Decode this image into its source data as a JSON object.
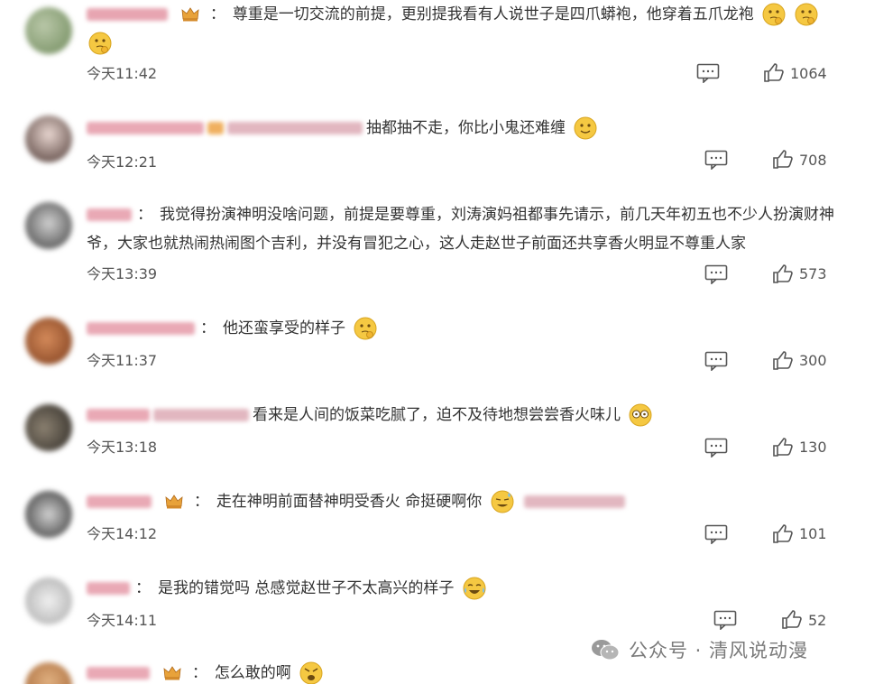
{
  "comments": [
    {
      "text": "尊重是一切交流的前提，更别提我看有人说世子是四爪蟒袍，他穿着五爪龙袍",
      "time": "今天11:42",
      "likes": "1064"
    },
    {
      "text": "抽都抽不走，你比小鬼还难缠",
      "time": "今天12:21",
      "likes": "708"
    },
    {
      "text": "我觉得扮演神明没啥问题，前提是要尊重，刘涛演妈祖都事先请示，前几天年初五也不少人扮演财神爷，大家也就热闹热闹图个吉利，并没有冒犯之心，这人走赵世子前面还共享香火明显不尊重人家",
      "time": "今天13:39",
      "likes": "573"
    },
    {
      "text": "他还蛮享受的样子",
      "time": "今天11:37",
      "likes": "300"
    },
    {
      "text": "看来是人间的饭菜吃腻了，迫不及待地想尝尝香火味儿",
      "time": "今天13:18",
      "likes": "130"
    },
    {
      "text": "走在神明前面替神明受香火 命挺硬啊你",
      "time": "今天14:12",
      "likes": "101"
    },
    {
      "text": "是我的错觉吗 总感觉赵世子不太高兴的样子",
      "time": "今天14:11",
      "likes": "52"
    },
    {
      "text": "怎么敢的啊",
      "time": "",
      "likes": ""
    }
  ],
  "watermark": {
    "text": "公众号 · 清风说动漫"
  },
  "icons": {
    "reply": "comment-icon",
    "like": "thumbs-up-icon",
    "vip": "crown-icon",
    "watermark": "wechat-icon"
  },
  "colors": {
    "text": "#333333",
    "meta": "#555555",
    "emoji": "#f5c842",
    "crown": "#e8a23a"
  }
}
